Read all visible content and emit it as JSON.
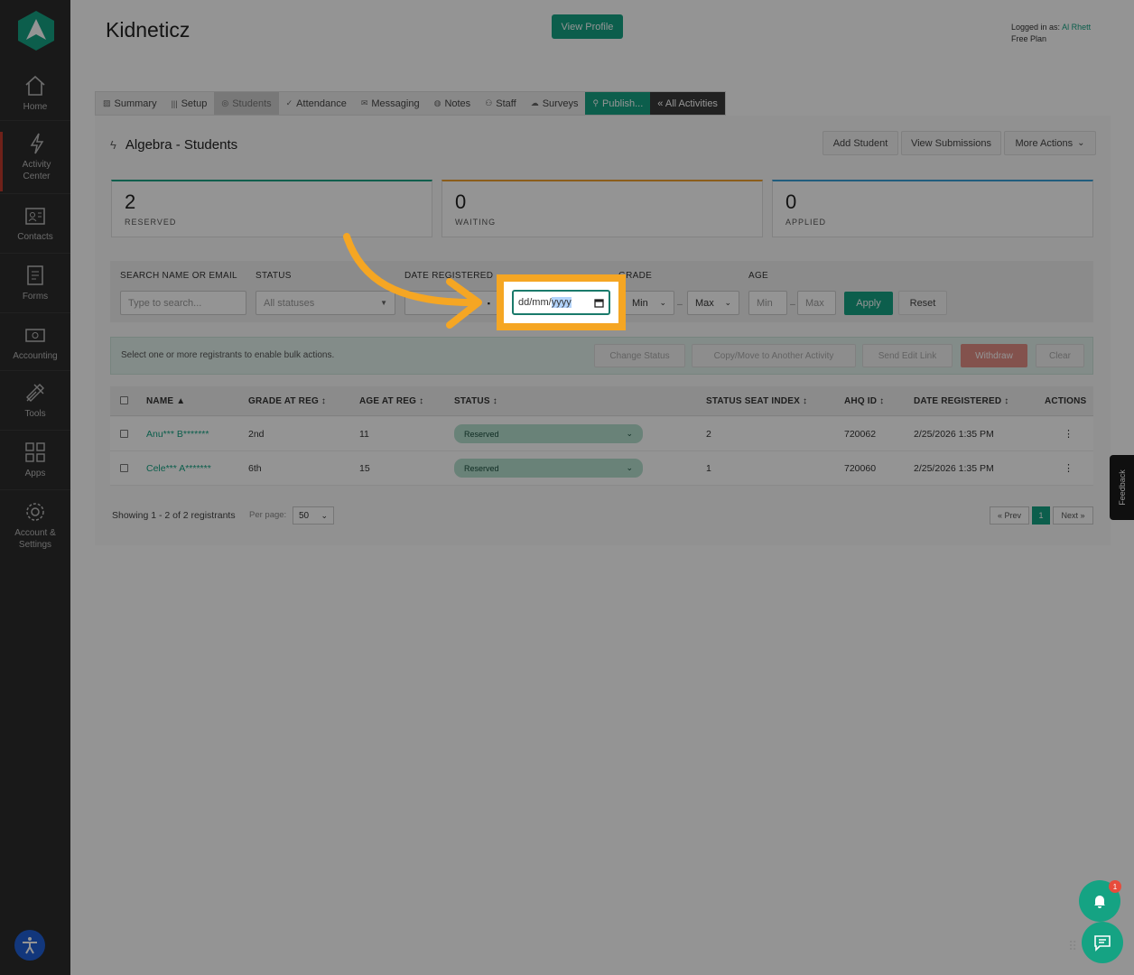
{
  "sidebar": {
    "items": [
      {
        "label": "Home",
        "icon": "home-icon"
      },
      {
        "label": "Activity\nCenter",
        "icon": "lightning-icon"
      },
      {
        "label": "Contacts",
        "icon": "contacts-icon"
      },
      {
        "label": "Forms",
        "icon": "forms-icon"
      },
      {
        "label": "Accounting",
        "icon": "accounting-icon"
      },
      {
        "label": "Tools",
        "icon": "tools-icon"
      },
      {
        "label": "Apps",
        "icon": "apps-icon"
      },
      {
        "label": "Account &\nSettings",
        "icon": "gear-icon"
      }
    ]
  },
  "header": {
    "brand": "Kidneticz",
    "view_profile": "View Profile",
    "logged_in_prefix": "Logged in as: ",
    "user": "Al Rhett",
    "plan": "Free Plan"
  },
  "tabs": [
    {
      "label": "Summary",
      "icon": "summary-icon"
    },
    {
      "label": "Setup",
      "icon": "setup-icon"
    },
    {
      "label": "Students",
      "icon": "students-icon"
    },
    {
      "label": "Attendance",
      "icon": "check-icon"
    },
    {
      "label": "Messaging",
      "icon": "mail-icon"
    },
    {
      "label": "Notes",
      "icon": "notes-icon"
    },
    {
      "label": "Staff",
      "icon": "staff-icon"
    },
    {
      "label": "Surveys",
      "icon": "cloud-icon"
    },
    {
      "label": "Publish...",
      "icon": "link-icon"
    },
    {
      "label": "« All Activities",
      "icon": ""
    }
  ],
  "page": {
    "title": "Algebra - Students",
    "add_student": "Add Student",
    "view_submissions": "View Submissions",
    "more_actions": "More Actions"
  },
  "stats": [
    {
      "value": "2",
      "label": "RESERVED",
      "color": "#15a383"
    },
    {
      "value": "0",
      "label": "WAITING",
      "color": "#f0a030"
    },
    {
      "value": "0",
      "label": "APPLIED",
      "color": "#3aa0d8"
    }
  ],
  "filters": {
    "search_label": "SEARCH NAME OR EMAIL",
    "search_placeholder": "Type to search...",
    "status_label": "STATUS",
    "status_value": "All statuses",
    "date_label": "DATE REGISTERED",
    "date_to_placeholder": "dd/mm/",
    "date_to_selected": "yyyy",
    "grade_label": "GRADE",
    "grade_min": "Min",
    "grade_max": "Max",
    "age_label": "AGE",
    "age_min": "Min",
    "age_max": "Max",
    "apply": "Apply",
    "reset": "Reset"
  },
  "bulk": {
    "text": "Select one or more registrants to enable bulk actions.",
    "change_status": "Change Status",
    "copy_move": "Copy/Move to Another Activity",
    "send_edit": "Send Edit Link",
    "withdraw": "Withdraw",
    "clear": "Clear"
  },
  "table": {
    "columns": [
      "NAME ▲",
      "GRADE AT REG ↕",
      "AGE AT REG ↕",
      "STATUS ↕",
      "STATUS SEAT INDEX ↕",
      "AHQ ID ↕",
      "DATE REGISTERED ↕",
      "ACTIONS"
    ],
    "rows": [
      {
        "name": "Anu*** B*******",
        "grade": "2nd",
        "age": "11",
        "status": "Reserved",
        "seat": "2",
        "ahq": "720062",
        "date": "2/25/2026 1:35 PM"
      },
      {
        "name": "Cele*** A*******",
        "grade": "6th",
        "age": "15",
        "status": "Reserved",
        "seat": "1",
        "ahq": "720060",
        "date": "2/25/2026 1:35 PM"
      }
    ]
  },
  "footer": {
    "showing": "Showing 1 - 2 of 2 registrants",
    "per_page_label": "Per page:",
    "per_page": "50",
    "prev": "« Prev",
    "page": "1",
    "next": "Next »"
  },
  "feedback": "Feedback",
  "notification_count": "1",
  "colors": {
    "accent": "#15a383",
    "highlight": "#f5a623",
    "sidebar": "#2b2b2b"
  }
}
